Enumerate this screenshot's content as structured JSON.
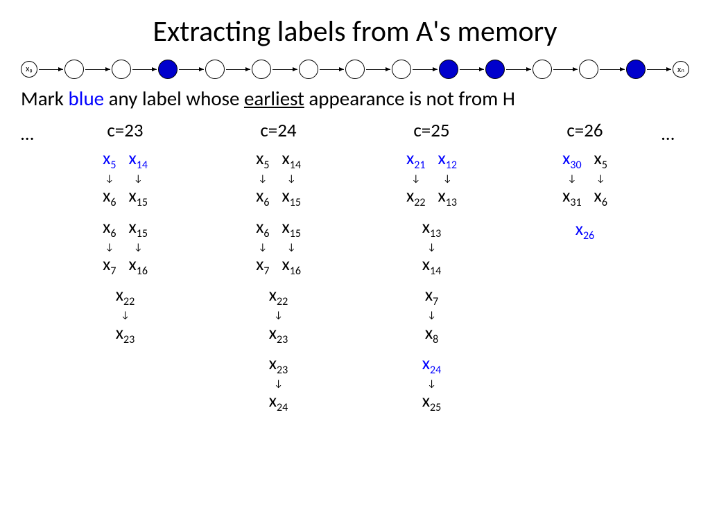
{
  "title": "Extracting labels from A's memory",
  "chain": {
    "start_label": "x₀",
    "end_label": "xₙ",
    "filled_positions": [
      2,
      8,
      9,
      12
    ],
    "total_inner": 13
  },
  "description": {
    "prefix": "Mark ",
    "blue_word": "blue",
    "mid": " any label whose ",
    "underlined": "earliest",
    "suffix": " appearance is not from H"
  },
  "dots": "…",
  "columns": [
    {
      "header": "c=23",
      "blocks": [
        {
          "type": "pair",
          "left": {
            "top": "x_5",
            "bot": "x_6",
            "blue": true
          },
          "right": {
            "top": "x_14",
            "bot": "x_15",
            "blue": true
          }
        },
        {
          "type": "pair",
          "left": {
            "top": "x_6",
            "bot": "x_7"
          },
          "right": {
            "top": "x_15",
            "bot": "x_16"
          }
        },
        {
          "type": "single",
          "top": "x_22",
          "bot": "x_23"
        }
      ]
    },
    {
      "header": "c=24",
      "blocks": [
        {
          "type": "pair",
          "left": {
            "top": "x_5",
            "bot": "x_6"
          },
          "right": {
            "top": "x_14",
            "bot": "x_15"
          }
        },
        {
          "type": "pair",
          "left": {
            "top": "x_6",
            "bot": "x_7"
          },
          "right": {
            "top": "x_15",
            "bot": "x_16"
          }
        },
        {
          "type": "single",
          "top": "x_22",
          "bot": "x_23"
        },
        {
          "type": "single",
          "top": "x_23",
          "bot": "x_24"
        }
      ]
    },
    {
      "header": "c=25",
      "blocks": [
        {
          "type": "pair",
          "left": {
            "top": "x_21",
            "bot": "x_22",
            "blue": true
          },
          "right": {
            "top": "x_12",
            "bot": "x_13",
            "blue": true
          }
        },
        {
          "type": "single",
          "top": "x_13",
          "bot": "x_14"
        },
        {
          "type": "single",
          "top": "x_7",
          "bot": "x_8"
        },
        {
          "type": "single",
          "top": "x_24",
          "bot": "x_25",
          "blue_top": true
        }
      ]
    },
    {
      "header": "c=26",
      "blocks": [
        {
          "type": "pair",
          "left": {
            "top": "x_30",
            "bot": "x_31",
            "blue": true
          },
          "right": {
            "top": "x_5",
            "bot": "x_6"
          }
        },
        {
          "type": "label",
          "text": "x_26",
          "blue": true
        }
      ]
    }
  ]
}
